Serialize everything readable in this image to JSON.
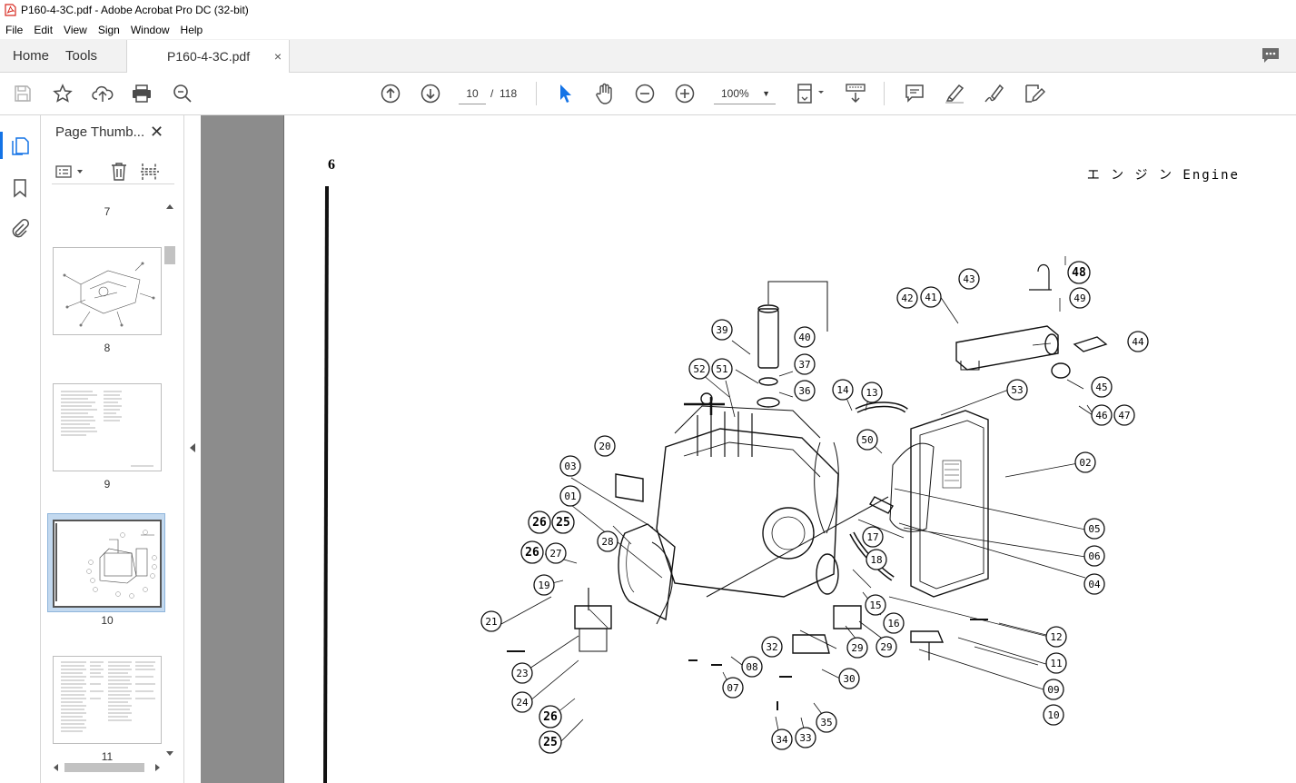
{
  "window": {
    "title": "P160-4-3C.pdf - Adobe Acrobat Pro DC (32-bit)"
  },
  "menu": [
    "File",
    "Edit",
    "View",
    "Sign",
    "Window",
    "Help"
  ],
  "tabs": {
    "home": "Home",
    "tools": "Tools",
    "document": "P160-4-3C.pdf",
    "close_glyph": "×"
  },
  "toolbar": {
    "current_page": "10",
    "page_separator": "/",
    "total_pages": "118",
    "zoom": "100%",
    "icons": [
      "save-icon",
      "star-icon",
      "upload-icon",
      "print-icon",
      "zoom-search-icon",
      "page-up-icon",
      "page-down-icon",
      "select-cursor-icon",
      "hand-icon",
      "zoom-out-icon",
      "zoom-in-icon",
      "page-fit-icon",
      "scroll-mode-icon",
      "comment-icon",
      "highlight-icon",
      "sign-icon",
      "edit-icon"
    ]
  },
  "sidebar": {
    "panel_title": "Page Thumb...",
    "close_glyph": "✕",
    "thumbnails": [
      {
        "label": "7"
      },
      {
        "label": "8"
      },
      {
        "label": "9"
      },
      {
        "label": "10",
        "selected": true
      },
      {
        "label": "11"
      }
    ]
  },
  "document_page": {
    "page_number": "6",
    "header": "エ ン ジ ン  Engine",
    "callouts": [
      "01",
      "02",
      "03",
      "04",
      "05",
      "06",
      "07",
      "08",
      "09",
      "10",
      "11",
      "12",
      "13",
      "14",
      "15",
      "16",
      "17",
      "18",
      "19",
      "20",
      "21",
      "23",
      "24",
      "25",
      "26",
      "27",
      "28",
      "29",
      "30",
      "32",
      "33",
      "34",
      "35",
      "36",
      "37",
      "39",
      "40",
      "41",
      "42",
      "43",
      "44",
      "45",
      "46",
      "47",
      "48",
      "49",
      "50",
      "51",
      "52",
      "53"
    ]
  },
  "colors": {
    "accent": "#1473e6",
    "viewer_bg": "#8c8c8c",
    "thumb_selected": "#c3d9ef",
    "pdf_red": "#d7281f"
  }
}
